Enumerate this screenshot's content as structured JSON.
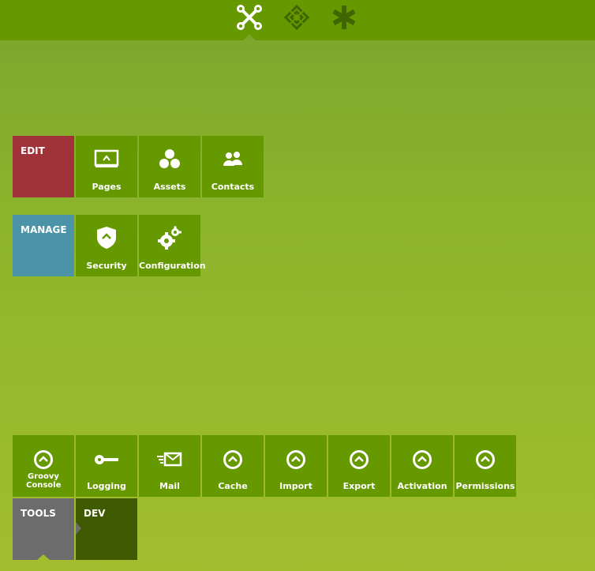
{
  "topnav": {
    "icons": [
      "nodes-icon",
      "diamond-pattern-icon",
      "asterisk-icon"
    ],
    "active": "nodes-icon"
  },
  "groups": {
    "edit": {
      "label": "EDIT",
      "color": "#a0323a",
      "items": [
        {
          "label": "Pages",
          "icon": "pages-icon"
        },
        {
          "label": "Assets",
          "icon": "assets-icon"
        },
        {
          "label": "Contacts",
          "icon": "contacts-icon"
        }
      ]
    },
    "manage": {
      "label": "MANAGE",
      "color": "#4b94a8",
      "items": [
        {
          "label": "Security",
          "icon": "shield-icon"
        },
        {
          "label": "Configuration",
          "icon": "gears-icon"
        }
      ]
    },
    "tools": {
      "items": [
        {
          "label": "Groovy Console",
          "icon": "chevron-circle-icon"
        },
        {
          "label": "Logging",
          "icon": "key-icon"
        },
        {
          "label": "Mail",
          "icon": "mail-icon"
        },
        {
          "label": "Cache",
          "icon": "chevron-circle-icon"
        },
        {
          "label": "Import",
          "icon": "chevron-circle-icon"
        },
        {
          "label": "Export",
          "icon": "chevron-circle-icon"
        },
        {
          "label": "Activation",
          "icon": "chevron-circle-icon"
        },
        {
          "label": "Permissions",
          "icon": "chevron-circle-icon"
        }
      ]
    },
    "tabs": {
      "tools_label": "TOOLS",
      "dev_label": "DEV"
    }
  },
  "colors": {
    "topbar": "#669900",
    "tile": "#669900",
    "tools_tab": "#6c6c6c",
    "dev_tab": "#3f5a00"
  }
}
